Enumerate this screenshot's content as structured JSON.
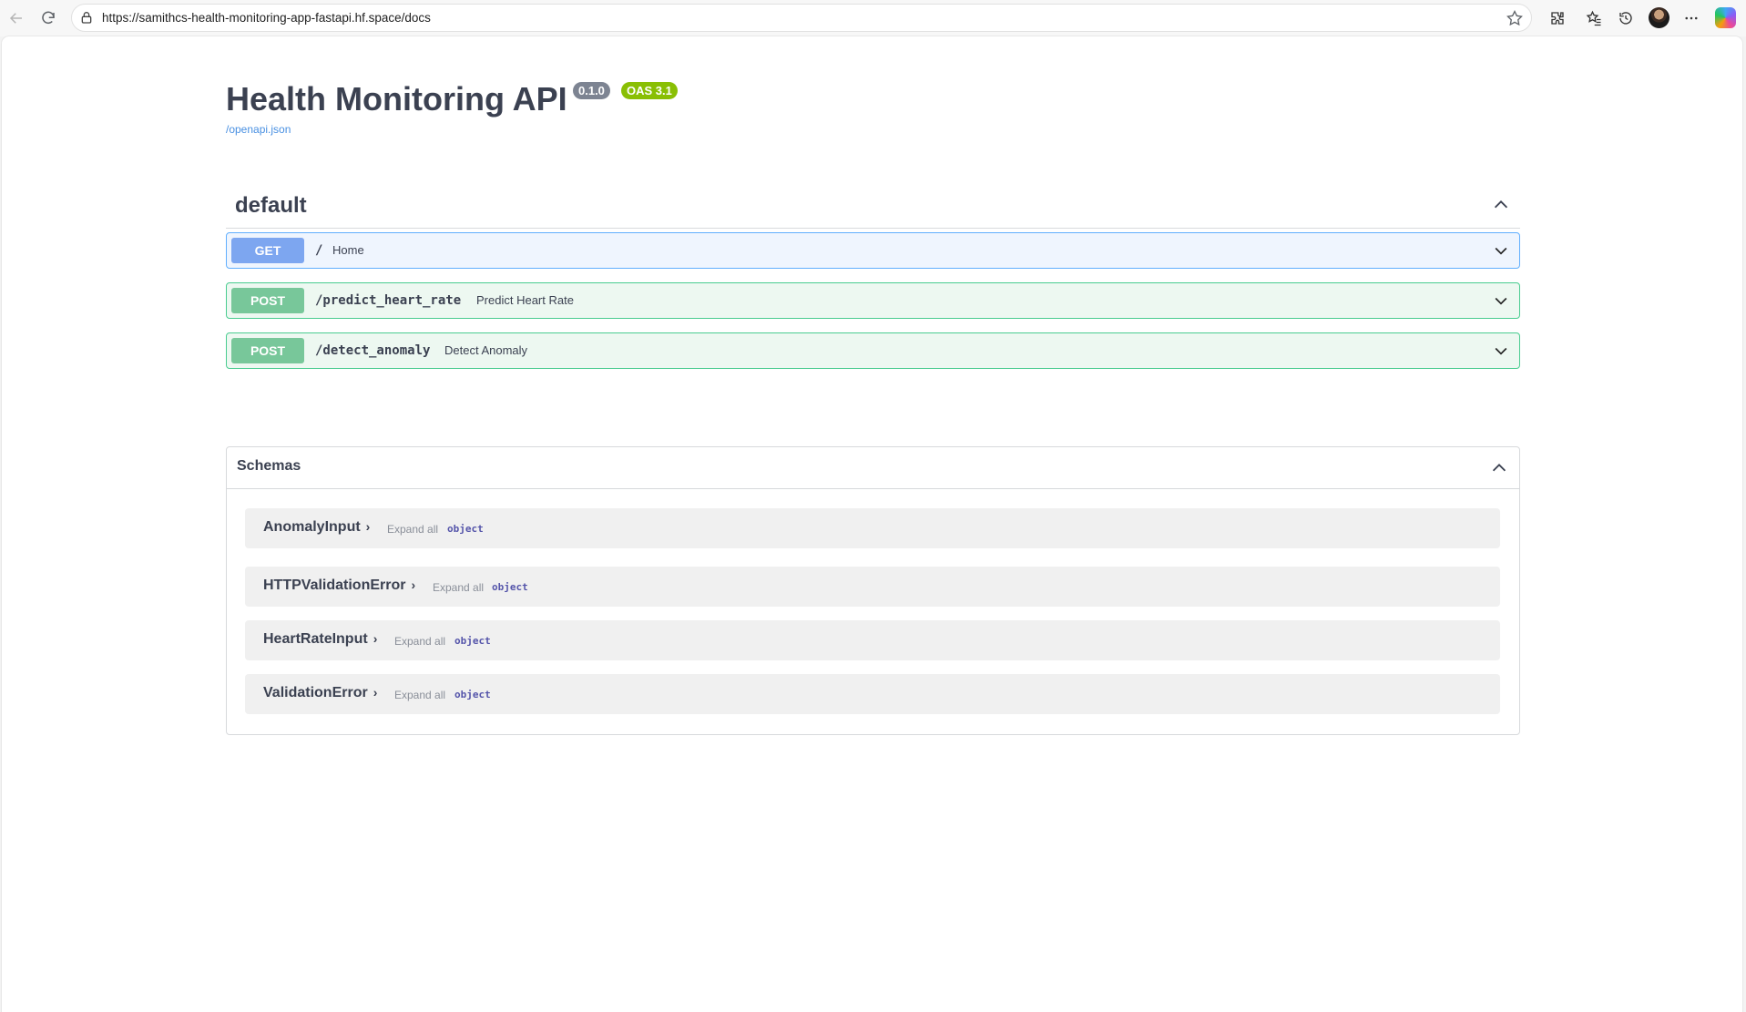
{
  "browser": {
    "url": "https://samithcs-health-monitoring-app-fastapi.hf.space/docs"
  },
  "api": {
    "title": "Health Monitoring API",
    "version": "0.1.0",
    "oas": "OAS 3.1",
    "openapi_link": "/openapi.json"
  },
  "tag": {
    "name": "default"
  },
  "operations": [
    {
      "method": "GET",
      "path": "/",
      "summary": "Home"
    },
    {
      "method": "POST",
      "path": "/predict_heart_rate",
      "summary": "Predict Heart Rate"
    },
    {
      "method": "POST",
      "path": "/detect_anomaly",
      "summary": "Detect Anomaly"
    }
  ],
  "schemas": {
    "title": "Schemas",
    "items": [
      {
        "name": "AnomalyInput",
        "expand": "Expand all",
        "type": "object"
      },
      {
        "name": "HTTPValidationError",
        "expand": "Expand all",
        "type": "object"
      },
      {
        "name": "HeartRateInput",
        "expand": "Expand all",
        "type": "object"
      },
      {
        "name": "ValidationError",
        "expand": "Expand all",
        "type": "object"
      }
    ]
  }
}
